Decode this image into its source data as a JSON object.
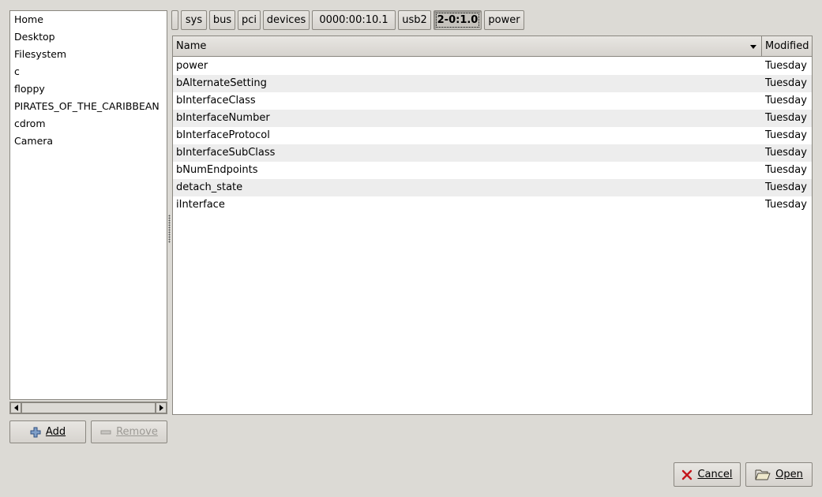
{
  "places": {
    "items": [
      "Home",
      "Desktop",
      "Filesystem",
      "c",
      "floppy",
      "PIRATES_OF_THE_CARIBBEAN",
      "cdrom",
      "Camera"
    ]
  },
  "places_buttons": {
    "add_label": "Add",
    "remove_label": "Remove"
  },
  "path_bar": {
    "segments": [
      "sys",
      "bus",
      "pci",
      "devices",
      "0000:00:10.1",
      "usb2",
      "2-0:1.0",
      "power"
    ],
    "active": "2-0:1.0"
  },
  "file_list": {
    "columns": {
      "name": "Name",
      "modified": "Modified"
    },
    "rows": [
      {
        "name": "power",
        "modified": "Tuesday"
      },
      {
        "name": "bAlternateSetting",
        "modified": "Tuesday"
      },
      {
        "name": "bInterfaceClass",
        "modified": "Tuesday"
      },
      {
        "name": "bInterfaceNumber",
        "modified": "Tuesday"
      },
      {
        "name": "bInterfaceProtocol",
        "modified": "Tuesday"
      },
      {
        "name": "bInterfaceSubClass",
        "modified": "Tuesday"
      },
      {
        "name": "bNumEndpoints",
        "modified": "Tuesday"
      },
      {
        "name": "detach_state",
        "modified": "Tuesday"
      },
      {
        "name": "iInterface",
        "modified": "Tuesday"
      }
    ]
  },
  "dialog_buttons": {
    "cancel_label": "Cancel",
    "open_label": "Open"
  },
  "icons": {
    "add": "plus-icon",
    "remove": "minus-icon",
    "cancel": "x-icon",
    "open": "folder-open-icon",
    "sort": "sort-descending-icon"
  },
  "colors": {
    "window_bg": "#dcdad5",
    "alt_row": "#ededed",
    "cancel_red": "#c4161c"
  }
}
